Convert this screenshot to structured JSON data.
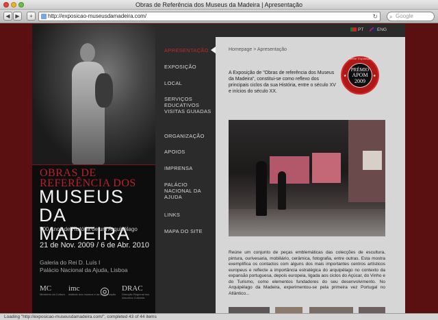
{
  "window": {
    "title": "Obras de Referência dos Museus da Madeira | Apresentação",
    "url": "http://exposicao-museusdamadeira.com/",
    "search_placeholder": "Google",
    "back_icon": "◀",
    "forward_icon": "▶",
    "add_icon": "+",
    "reload_icon": "↻",
    "search_icon": "⌕"
  },
  "left": {
    "title_red": "OBRAS DE REFERÊNCIA DOS",
    "title_big": "MUSEUS DA MADEIRA",
    "subtitle": "500 Anos de História de um Arquipélago",
    "dates": "21 de Nov. 2009 / 6 de Abr. 2010",
    "venue_line1": "Galeria do Rei D. Luís I",
    "venue_line2": "Palácio Nacional da Ajuda, Lisboa",
    "logos": [
      {
        "mark": "MC",
        "caption": "Ministério da Cultura"
      },
      {
        "mark": "imc",
        "caption": "instituto dos museus e da conservação"
      },
      {
        "mark": "◎",
        "caption": ""
      },
      {
        "mark": "DRAC",
        "caption": "Direcção Regional dos Assuntos Culturais"
      }
    ]
  },
  "nav": {
    "items": [
      {
        "label": "APRESENTAÇÃO",
        "active": true
      },
      {
        "label": "EXPOSIÇÃO"
      },
      {
        "label": "LOCAL"
      },
      {
        "label": "SERVIÇOS EDUCATIVOS VISITAS GUIADAS"
      },
      {
        "label": "ORGANIZAÇÃO"
      },
      {
        "label": "APOIOS"
      },
      {
        "label": "IMPRENSA"
      },
      {
        "label": "PALÁCIO NACIONAL DA AJUDA"
      },
      {
        "label": "LINKS"
      },
      {
        "label": "MAPA DO SITE"
      }
    ]
  },
  "lang": {
    "pt": "PT",
    "eng": "ENG"
  },
  "content": {
    "breadcrumb": "Homepage > Apresentação",
    "intro": "A Exposição de \"Obras de referência dos Museus da Madeira\", constitui-se como reflexo dos principais ciclos da sua História, entre o século XV e inícios do século XX.",
    "body": "Reúne um conjunto de peças emblemáticas das colecções de escultura, pintura, ourivesaria, mobiliário, cerâmica, fotografia, entre outras. Esta mostra exemplifica os contactos com alguns dos mais importantes centros artísticos europeus e reflecte a importância estratégica do arquipélago no contexto da expansão portuguesa, depois europeia, ligada aos ciclos do Açúcar, do Vinho e do Turismo, como elementos fundadores do seu desenvolvimento. No Arquipélago da Madeira, experimentou-se pela primeira vez Portugal no Atlântico...",
    "seal": {
      "line1": "PRÉMIO",
      "line2": "APOM",
      "line3": "2009",
      "ring": "Melhor Exposição"
    }
  },
  "status": "Loading \"http://exposicao-museusdamadeira.com/\", completed 43 of 44 items",
  "colors": {
    "accent_red": "#c3262c",
    "page_bg": "#5a0f10",
    "nav_bg": "#2b2b2b"
  }
}
